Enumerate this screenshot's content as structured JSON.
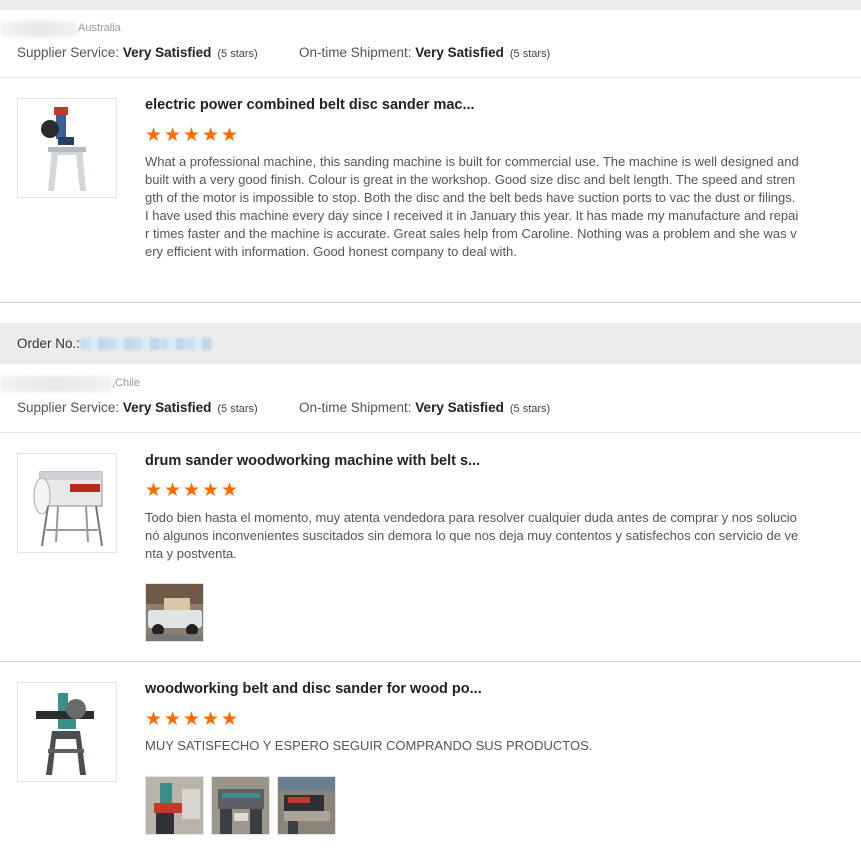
{
  "buyer1": {
    "country": "Australia"
  },
  "ratings1": {
    "supplier_label": "Supplier Service: ",
    "supplier_value": "Very Satisfied",
    "supplier_stars": "(5 stars)",
    "shipment_label": "On-time Shipment: ",
    "shipment_value": "Very Satisfied",
    "shipment_stars": "(5 stars)"
  },
  "review1": {
    "title": "electric power combined belt disc sander mac...",
    "rating": 5,
    "text": "What a professional machine, this sanding machine is built for commercial use. The machine is well designed and built with a very good finish. Colour is great in the workshop. Good size disc and belt length. The speed and strength of the motor is impossible to stop. Both the disc and the belt beds have suction ports to vac the dust or filings. I have used this machine every day since I received it in January this year. It has made my manufacture and repair times faster and the machine is accurate. Great sales help from Caroline. Nothing was a problem and she was very efficient with information. Good honest company to deal with."
  },
  "order": {
    "label": "Order No.:"
  },
  "buyer2": {
    "country": ",Chile"
  },
  "ratings2": {
    "supplier_label": "Supplier Service: ",
    "supplier_value": "Very Satisfied",
    "supplier_stars": "(5 stars)",
    "shipment_label": "On-time Shipment: ",
    "shipment_value": "Very Satisfied",
    "shipment_stars": "(5 stars)"
  },
  "review2": {
    "title": "drum sander woodworking machine with belt s...",
    "rating": 5,
    "text": "Todo bien hasta el momento, muy atenta vendedora para resolver cualquier duda antes de comprar y nos solucionó algunos inconvenientes suscitados sin demora lo que nos deja muy contentos y satisfechos con servicio de venta y postventa."
  },
  "review3": {
    "title": "woodworking belt and disc sander for wood po...",
    "rating": 5,
    "text": "MUY SATISFECHO Y ESPERO SEGUIR COMPRANDO SUS PRODUCTOS."
  },
  "colors": {
    "star": "#ff6a00",
    "order_bar": "#ececec"
  }
}
